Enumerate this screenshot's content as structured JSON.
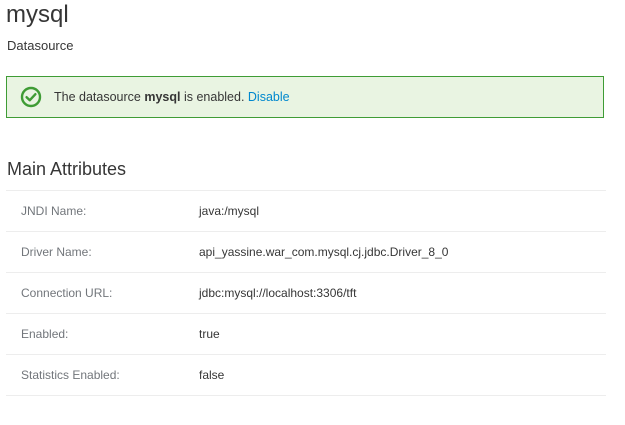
{
  "header": {
    "title": "mysql",
    "subtitle": "Datasource"
  },
  "alert": {
    "icon": "check-circle-icon",
    "text_before": "The datasource ",
    "name": "mysql",
    "text_after": " is enabled. ",
    "link_label": "Disable",
    "border_color": "#3f9c35",
    "background_color": "#e9f4e2",
    "link_color": "#0088ce"
  },
  "main_attributes": {
    "title": "Main Attributes",
    "rows": [
      {
        "label": "JNDI Name:",
        "value": "java:/mysql"
      },
      {
        "label": "Driver Name:",
        "value": "api_yassine.war_com.mysql.cj.jdbc.Driver_8_0"
      },
      {
        "label": "Connection URL:",
        "value": "jdbc:mysql://localhost:3306/tft"
      },
      {
        "label": "Enabled:",
        "value": "true"
      },
      {
        "label": "Statistics Enabled:",
        "value": "false"
      }
    ]
  }
}
